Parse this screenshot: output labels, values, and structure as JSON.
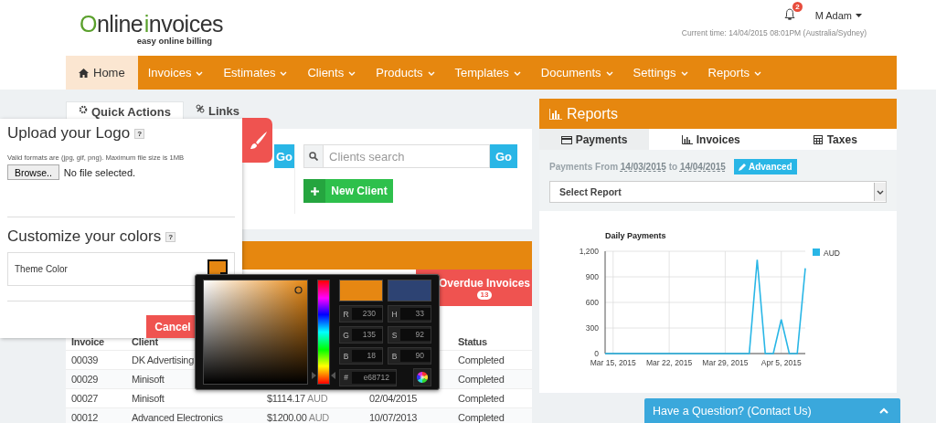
{
  "header": {
    "logo": {
      "words": [
        "Online",
        "invoices"
      ],
      "tagline": "easy online billing"
    },
    "notifications": {
      "count": "2"
    },
    "user": {
      "name": "M Adam"
    },
    "current_time": "Current time: 14/04/2015 08:01PM (Australia/Sydney)"
  },
  "nav": [
    {
      "label": "Home",
      "selected": true,
      "dropdown": false
    },
    {
      "label": "Invoices",
      "selected": false,
      "dropdown": true
    },
    {
      "label": "Estimates",
      "selected": false,
      "dropdown": true
    },
    {
      "label": "Clients",
      "selected": false,
      "dropdown": true
    },
    {
      "label": "Products",
      "selected": false,
      "dropdown": true
    },
    {
      "label": "Templates",
      "selected": false,
      "dropdown": true
    },
    {
      "label": "Documents",
      "selected": false,
      "dropdown": true
    },
    {
      "label": "Settings",
      "selected": false,
      "dropdown": true
    },
    {
      "label": "Reports",
      "selected": false,
      "dropdown": true
    }
  ],
  "quick_actions": {
    "tabs": [
      {
        "label": "Quick Actions",
        "selected": true
      },
      {
        "label": "Links",
        "selected": false
      }
    ],
    "go_button": "Go",
    "clients_search": {
      "placeholder": "Clients search",
      "button": "Go"
    },
    "new_client_button": "New Client"
  },
  "invoices_panel": {
    "overdue_tab": {
      "label": "Overdue Invoices",
      "count": "13"
    },
    "table": {
      "headers": {
        "invoice": "Invoice",
        "client": "Client",
        "status": "Status"
      },
      "rows": [
        {
          "invoice": "00039",
          "client": "DK Advertising",
          "status": "Completed"
        },
        {
          "invoice": "00029",
          "client": "Minisoft",
          "status": "Completed"
        },
        {
          "invoice": "00027",
          "client": "Minisoft",
          "amount": "$1114.17",
          "currency": "AUD",
          "date": "02/04/2015",
          "status": "Completed"
        },
        {
          "invoice": "00012",
          "client": "Advanced Electronics",
          "amount": "$1200.00",
          "currency": "AUD",
          "date": "10/07/2013",
          "status": "Completed"
        }
      ]
    }
  },
  "reports": {
    "title": "Reports",
    "tabs": [
      {
        "label": "Payments",
        "selected": true
      },
      {
        "label": "Invoices",
        "selected": false
      },
      {
        "label": "Taxes",
        "selected": false
      }
    ],
    "range": {
      "prefix": "Payments From",
      "from": "14/03/2015",
      "joiner": "to",
      "to": "14/04/2015"
    },
    "advanced_button": "Advanced",
    "report_select": {
      "value": "Select Report"
    },
    "chart_data": {
      "type": "line",
      "title": "Daily Payments",
      "categories": [
        null,
        "Mar 15, 2015",
        null,
        null,
        null,
        null,
        null,
        null,
        "Mar 22, 2015",
        null,
        null,
        null,
        null,
        null,
        null,
        "Mar 29, 2015",
        null,
        null,
        null,
        null,
        null,
        null,
        "Apr 5, 2015",
        null,
        null,
        null
      ],
      "series": [
        {
          "name": "AUD",
          "color": "#29b6e6",
          "values": [
            0,
            0,
            0,
            0,
            0,
            0,
            0,
            0,
            0,
            0,
            0,
            0,
            0,
            0,
            0,
            0,
            0,
            0,
            0,
            1100,
            0,
            0,
            400,
            0,
            0,
            1000
          ]
        }
      ],
      "grid": true,
      "ylim": [
        0,
        1200
      ],
      "yticks": [
        0,
        300,
        600,
        900,
        {
          "value": 1200,
          "label": "1,200"
        }
      ]
    }
  },
  "logo_panel": {
    "upload_title": "Upload your Logo",
    "upload_help": "?",
    "formats_note": "Valid formats are (jpg, gif, png). Maximum file size is 1MB",
    "browse_button": "Browse..",
    "file_status": "No file selected.",
    "colors_title": "Customize your colors",
    "colors_help": "?",
    "theme_color": {
      "label": "Theme Color",
      "color": "#e68712"
    },
    "cancel_button": "Cancel"
  },
  "color_picker": {
    "swatches": [
      {
        "color": "#e68712"
      },
      {
        "color": "#2d4373"
      }
    ],
    "hue_slider": {
      "level": 0.09
    },
    "fields": [
      {
        "label": "R",
        "value": "230"
      },
      {
        "label": "H",
        "value": "33"
      },
      {
        "label": "G",
        "value": "135"
      },
      {
        "label": "S",
        "value": "92"
      },
      {
        "label": "B",
        "value": "18"
      },
      {
        "label": "B",
        "value": "90"
      }
    ],
    "hex_label": "#",
    "hex": "e68712"
  },
  "contact_bar": {
    "label": "Have a Question? (Contact Us)"
  }
}
